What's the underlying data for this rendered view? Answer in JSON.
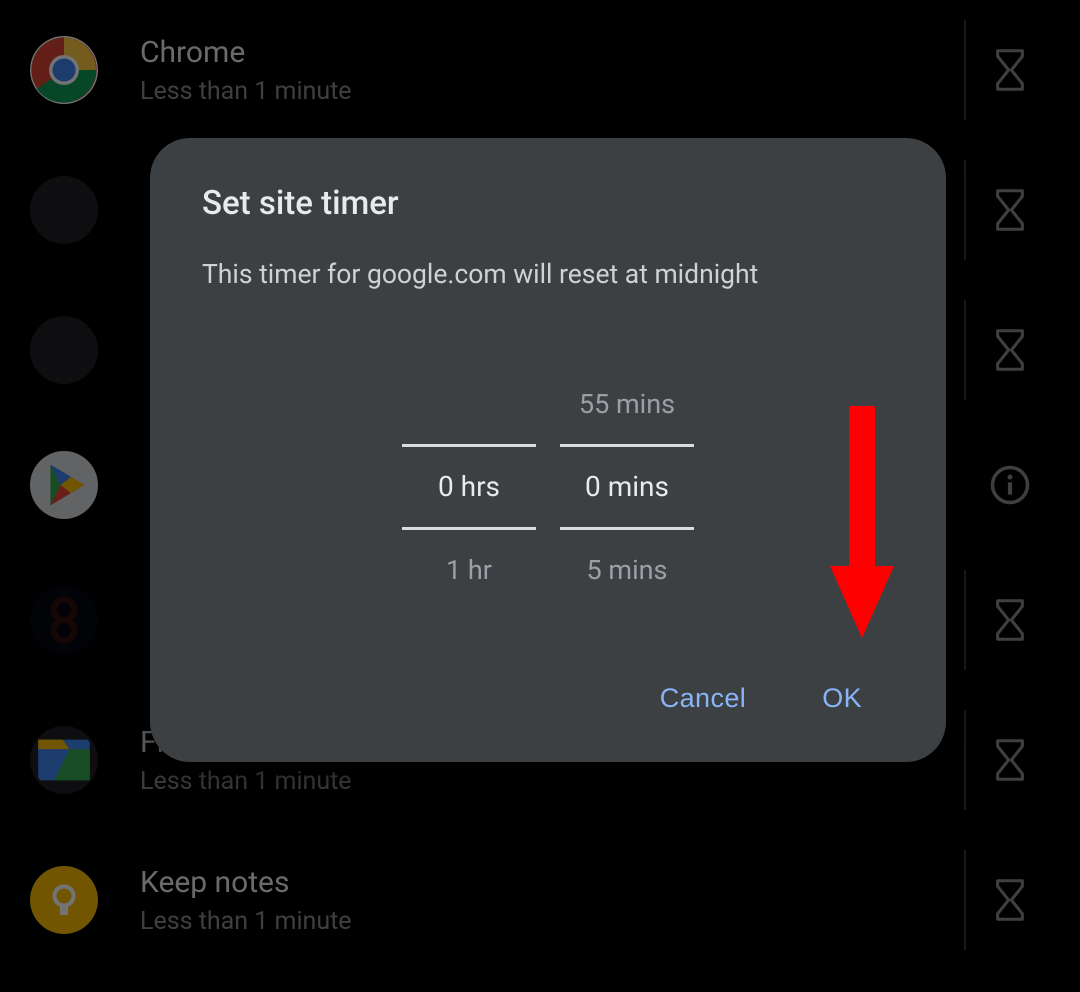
{
  "apps": [
    {
      "name": "Chrome",
      "usage": "Less than 1 minute",
      "action": "hourglass"
    },
    {
      "name": "",
      "usage": "",
      "action": "hourglass"
    },
    {
      "name": "",
      "usage": "",
      "action": "hourglass"
    },
    {
      "name": "",
      "usage": "",
      "action": "info"
    },
    {
      "name": "",
      "usage": "",
      "action": "hourglass"
    },
    {
      "name": "Files",
      "usage": "Less than 1 minute",
      "action": "hourglass"
    },
    {
      "name": "Keep notes",
      "usage": "Less than 1 minute",
      "action": "hourglass"
    }
  ],
  "dialog": {
    "title": "Set site timer",
    "message": "This timer for google.com will reset at midnight",
    "picker": {
      "hours": {
        "prev": "",
        "selected": "0 hrs",
        "next": "1 hr"
      },
      "minutes": {
        "prev": "55 mins",
        "selected": "0 mins",
        "next": "5 mins"
      }
    },
    "cancel": "Cancel",
    "ok": "OK"
  },
  "annotation": {
    "type": "red-arrow",
    "points_to": "ok-button"
  }
}
